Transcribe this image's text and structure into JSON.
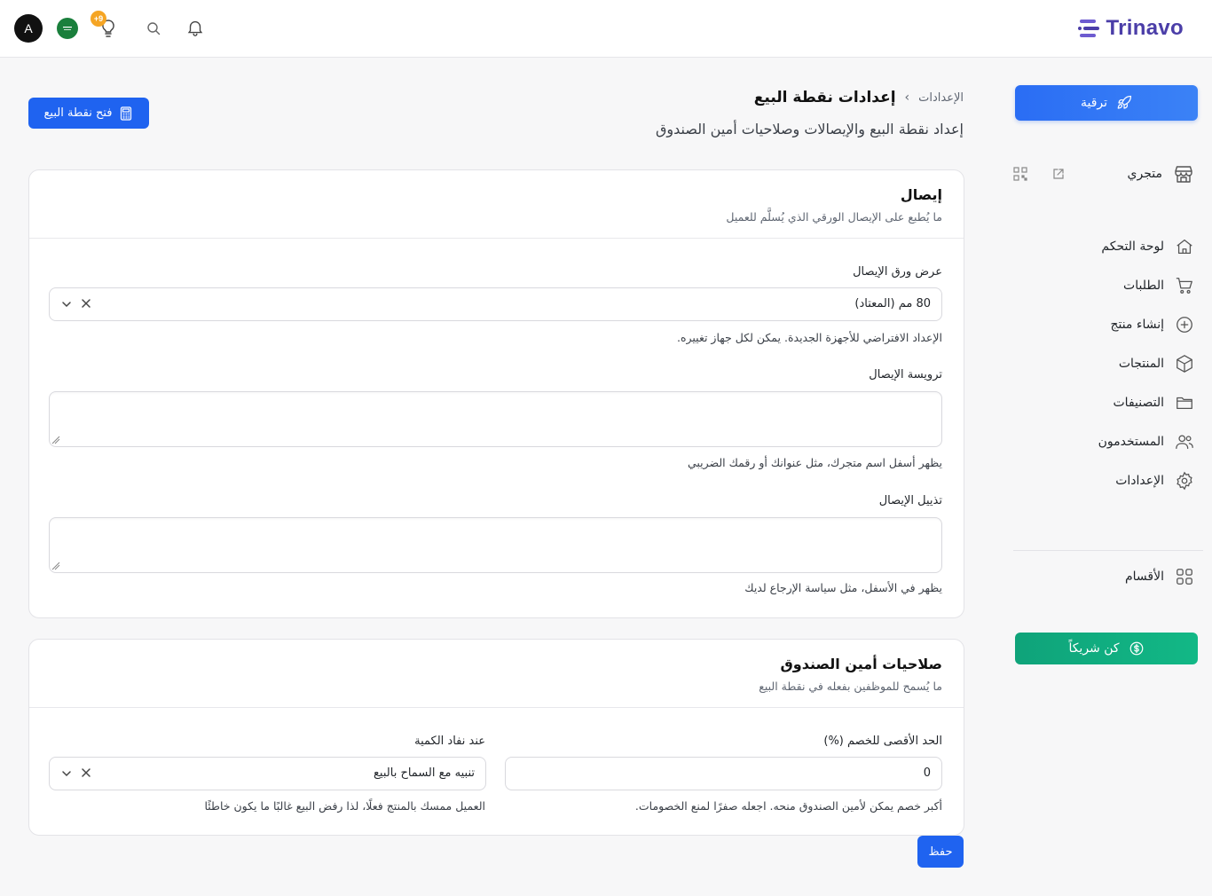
{
  "header": {
    "brand": "Trinavo",
    "avatar_letter": "A",
    "bulb_badge": "+9",
    "accent": "#4b3ea8"
  },
  "sidebar": {
    "upgrade_label": "ترقية",
    "store_label": "متجري",
    "items": [
      {
        "label": "لوحة التحكم",
        "icon": "home-icon"
      },
      {
        "label": "الطلبات",
        "icon": "cart-icon"
      },
      {
        "label": "إنشاء منتج",
        "icon": "plus-circle-icon"
      },
      {
        "label": "المنتجات",
        "icon": "box-icon"
      },
      {
        "label": "التصنيفات",
        "icon": "folder-icon"
      },
      {
        "label": "المستخدمون",
        "icon": "users-icon"
      },
      {
        "label": "الإعدادات",
        "icon": "gear-icon"
      }
    ],
    "sections_label": "الأقسام",
    "partner_label": "كن شريكاً"
  },
  "page": {
    "breadcrumb_parent": "الإعدادات",
    "breadcrumb_sep": "›",
    "title": "إعدادات نقطة البيع",
    "subtitle": "إعداد نقطة البيع والإيصالات وصلاحيات أمين الصندوق",
    "open_pos_label": "فتح نقطة البيع",
    "save_label": "حفظ"
  },
  "receipt_card": {
    "title": "إيصال",
    "description": "ما يُطبع على الإيصال الورقي الذي يُسلَّم للعميل",
    "paper_width_label": "عرض ورق الإيصال",
    "paper_width_value": "80 مم (المعتاد)",
    "paper_width_hint": "الإعداد الافتراضي للأجهزة الجديدة. يمكن لكل جهاز تغييره.",
    "header_label": "ترويسة الإيصال",
    "header_value": "",
    "header_hint": "يظهر أسفل اسم متجرك، مثل عنوانك أو رقمك الضريبي",
    "footer_label": "تذييل الإيصال",
    "footer_value": "",
    "footer_hint": "يظهر في الأسفل، مثل سياسة الإرجاع لديك"
  },
  "cashier_card": {
    "title": "صلاحيات أمين الصندوق",
    "description": "ما يُسمح للموظفين بفعله في نقطة البيع",
    "max_discount_label": "الحد الأقصى للخصم (%)",
    "max_discount_value": "0",
    "max_discount_hint": "أكبر خصم يمكن لأمين الصندوق منحه. اجعله صفرًا لمنع الخصومات.",
    "out_of_stock_label": "عند نفاد الكمية",
    "out_of_stock_value": "تنبيه مع السماح بالبيع",
    "out_of_stock_hint": "العميل ممسك بالمنتج فعلًا، لذا رفض البيع غالبًا ما يكون خاطئًا"
  }
}
